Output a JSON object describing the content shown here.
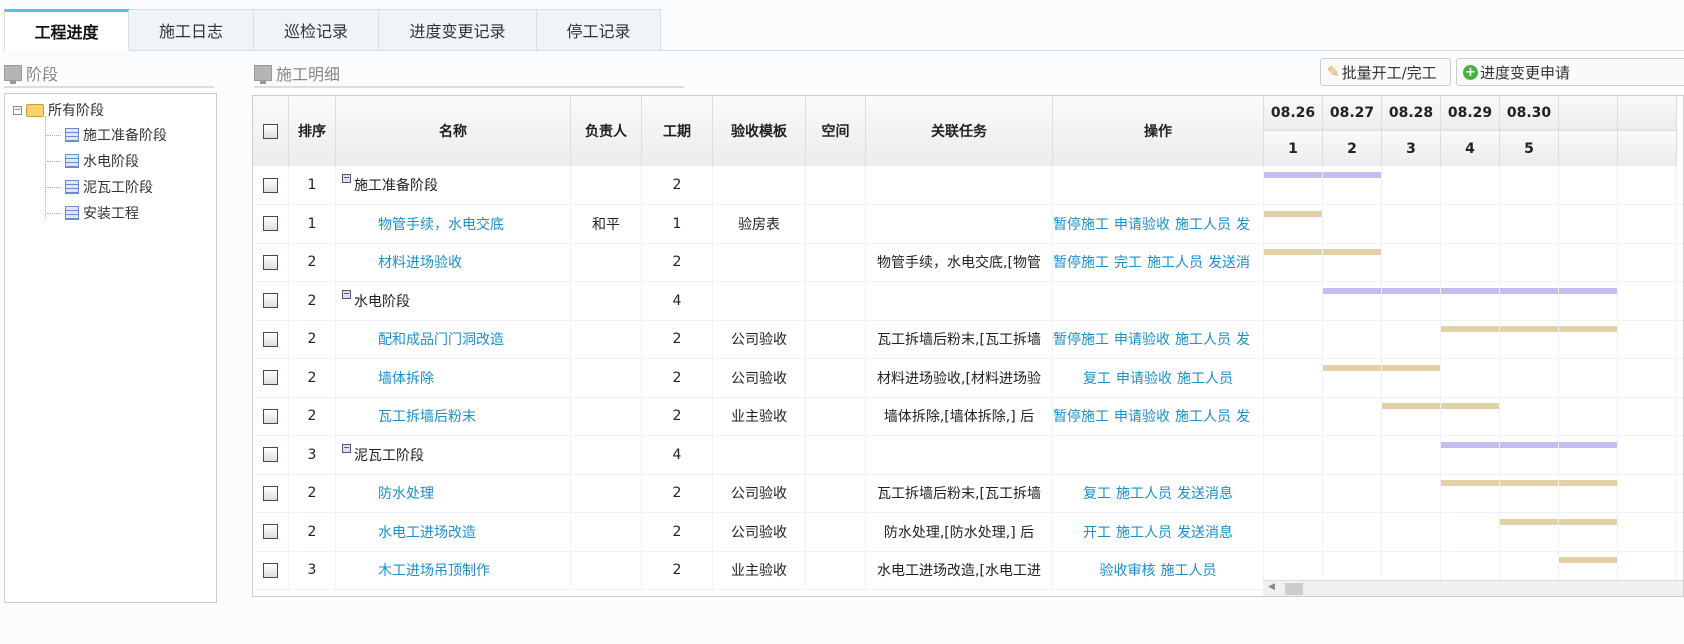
{
  "tabs": [
    "工程进度",
    "施工日志",
    "巡检记录",
    "进度变更记录",
    "停工记录"
  ],
  "left_panel": {
    "title": "阶段",
    "root": "所有阶段",
    "children": [
      "施工准备阶段",
      "水电阶段",
      "泥瓦工阶段",
      "安装工程"
    ]
  },
  "right_panel": {
    "title": "施工明细",
    "batch_button": "批量开工/完工",
    "change_button": "进度变更申请"
  },
  "columns": [
    "排序",
    "名称",
    "负责人",
    "工期",
    "验收模板",
    "空间",
    "关联任务",
    "操作"
  ],
  "gantt": {
    "dates": [
      "08.26",
      "08.27",
      "08.28",
      "08.29",
      "08.30"
    ],
    "days": [
      "1",
      "2",
      "3",
      "4",
      "5"
    ],
    "phase_color": "#c1bff0",
    "task_color": "#e4d0a6"
  },
  "rows": [
    {
      "sort": "1",
      "name": "施工准备阶段",
      "phase": true,
      "owner": "",
      "duration": "2",
      "template": "",
      "space": "",
      "related": "",
      "ops": [],
      "start": 1,
      "span": 2
    },
    {
      "sort": "1",
      "name": "物管手续，水电交底",
      "phase": false,
      "owner": "和平",
      "duration": "1",
      "template": "验房表",
      "space": "",
      "related": "",
      "ops": [
        "暂停施工",
        "申请验收",
        "施工人员",
        "发"
      ],
      "start": 1,
      "span": 1
    },
    {
      "sort": "2",
      "name": "材料进场验收",
      "phase": false,
      "owner": "",
      "duration": "2",
      "template": "",
      "space": "",
      "related": "物管手续，水电交底,[物管",
      "ops": [
        "暂停施工",
        "完工",
        "施工人员",
        "发送消"
      ],
      "start": 1,
      "span": 2
    },
    {
      "sort": "2",
      "name": "水电阶段",
      "phase": true,
      "owner": "",
      "duration": "4",
      "template": "",
      "space": "",
      "related": "",
      "ops": [],
      "start": 2,
      "span": 5
    },
    {
      "sort": "2",
      "name": "配和成品门门洞改造",
      "phase": false,
      "owner": "",
      "duration": "2",
      "template": "公司验收",
      "space": "",
      "related": "瓦工拆墙后粉末,[瓦工拆墙",
      "ops": [
        "暂停施工",
        "申请验收",
        "施工人员",
        "发"
      ],
      "start": 4,
      "span": 3
    },
    {
      "sort": "2",
      "name": "墙体拆除",
      "phase": false,
      "owner": "",
      "duration": "2",
      "template": "公司验收",
      "space": "",
      "related": "材料进场验收,[材料进场验",
      "ops": [
        "复工",
        "申请验收",
        "施工人员"
      ],
      "start": 2,
      "span": 2
    },
    {
      "sort": "2",
      "name": "瓦工拆墙后粉末",
      "phase": false,
      "owner": "",
      "duration": "2",
      "template": "业主验收",
      "space": "",
      "related": "墙体拆除,[墙体拆除,] 后",
      "ops": [
        "暂停施工",
        "申请验收",
        "施工人员",
        "发"
      ],
      "start": 3,
      "span": 2
    },
    {
      "sort": "3",
      "name": "泥瓦工阶段",
      "phase": true,
      "owner": "",
      "duration": "4",
      "template": "",
      "space": "",
      "related": "",
      "ops": [],
      "start": 4,
      "span": 3
    },
    {
      "sort": "2",
      "name": "防水处理",
      "phase": false,
      "owner": "",
      "duration": "2",
      "template": "公司验收",
      "space": "",
      "related": "瓦工拆墙后粉末,[瓦工拆墙",
      "ops": [
        "复工",
        "施工人员",
        "发送消息"
      ],
      "start": 4,
      "span": 3
    },
    {
      "sort": "2",
      "name": "水电工进场改造",
      "phase": false,
      "owner": "",
      "duration": "2",
      "template": "公司验收",
      "space": "",
      "related": "防水处理,[防水处理,] 后",
      "ops": [
        "开工",
        "施工人员",
        "发送消息"
      ],
      "start": 5,
      "span": 2
    },
    {
      "sort": "3",
      "name": "木工进场吊顶制作",
      "phase": false,
      "owner": "",
      "duration": "2",
      "template": "业主验收",
      "space": "",
      "related": "水电工进场改造,[水电工进",
      "ops": [
        "验收审核",
        "施工人员"
      ],
      "start": 6,
      "span": 1
    }
  ]
}
